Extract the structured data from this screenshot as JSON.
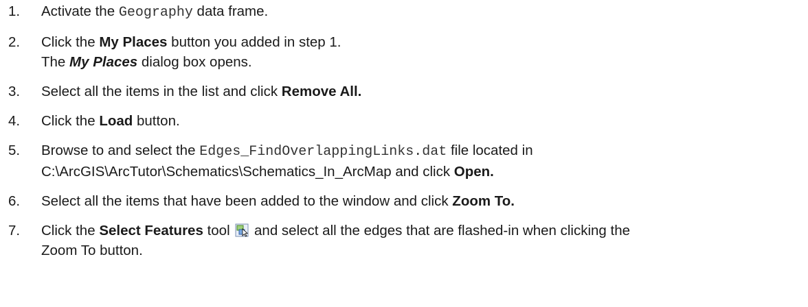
{
  "steps": [
    {
      "num": "1.",
      "pre": "Activate the ",
      "code": "Geography",
      "post": " data frame."
    },
    {
      "num": "2.",
      "pre": "Click the ",
      "bold": "My Places",
      "post": " button you added in step 1.",
      "line2_pre": "The ",
      "line2_bolditalic": "My Places",
      "line2_post": " dialog box opens."
    },
    {
      "num": "3.",
      "pre": "Select all the items in the list and click ",
      "bold": "Remove All."
    },
    {
      "num": "4.",
      "pre": "Click the ",
      "bold": "Load",
      "post": " button."
    },
    {
      "num": "5.",
      "pre": "Browse to and select the ",
      "code": "Edges_FindOverlappingLinks.dat",
      "post": " file located in",
      "line2_pre": "C:\\ArcGIS\\ArcTutor\\Schematics\\Schematics_In_ArcMap and click ",
      "line2_bold": "Open."
    },
    {
      "num": "6.",
      "pre": "Select all the items that have been added to the window and click ",
      "bold": "Zoom To."
    },
    {
      "num": "7.",
      "pre": "Click the ",
      "bold": "Select Features",
      "mid": " tool ",
      "post": " and select all the edges that are flashed-in when clicking the",
      "line2_pre": "Zoom To button.",
      "icon": "select-features-tool-icon"
    }
  ]
}
